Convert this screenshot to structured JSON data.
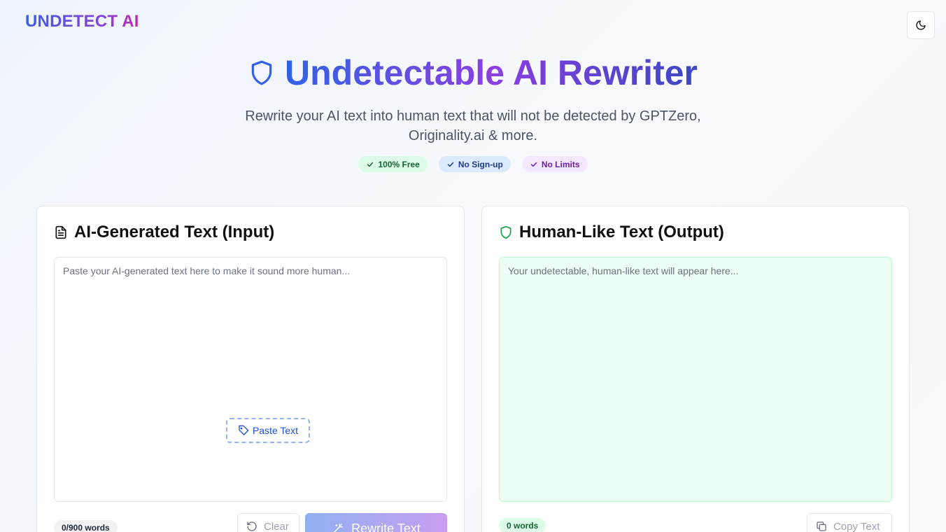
{
  "brand": {
    "logo": "UNDETECT AI"
  },
  "header": {
    "theme_toggle_icon": "moon-icon"
  },
  "hero": {
    "title": "Undetectable AI Rewriter",
    "subtitle": "Rewrite your AI text into human text that will not be detected by GPTZero, Originality.ai & more.",
    "badges": [
      {
        "label": "100% Free",
        "color": "#166534"
      },
      {
        "label": "No Sign-up",
        "color": "#1e3a8a"
      },
      {
        "label": "No Limits",
        "color": "#6b21a8"
      }
    ]
  },
  "input_panel": {
    "title": "AI-Generated Text (Input)",
    "placeholder": "Paste your AI-generated text here to make it sound more human...",
    "paste_label": "Paste Text",
    "word_count": "0/900 words",
    "clear_label": "Clear",
    "rewrite_label": "Rewrite Text"
  },
  "output_panel": {
    "title": "Human-Like Text (Output)",
    "placeholder": "Your undetectable, human-like text will appear here...",
    "word_count": "0 words",
    "copy_label": "Copy Text"
  },
  "colors": {
    "accent_blue": "#2f63e6",
    "accent_purple": "#8b3fe0",
    "success_green": "#16a34a"
  }
}
